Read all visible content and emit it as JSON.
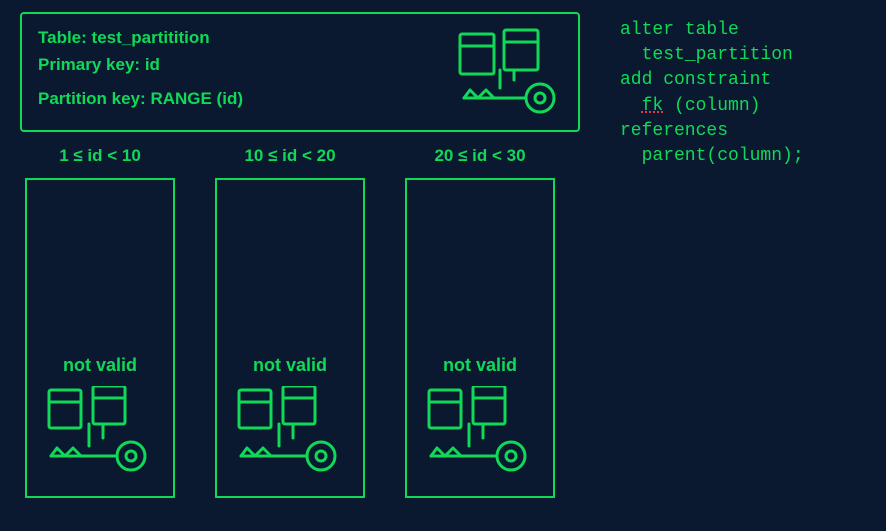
{
  "table": {
    "title_label": "Table:",
    "title_value": "test_partitition",
    "pk_label": "Primary key:",
    "pk_value": "id",
    "partkey_label": "Partition key:",
    "partkey_value": "RANGE (id)"
  },
  "partitions": [
    {
      "range": "1 ≤ id < 10",
      "status": "not valid"
    },
    {
      "range": "10 ≤ id < 20",
      "status": "not valid"
    },
    {
      "range": "20 ≤ id < 30",
      "status": "not valid"
    }
  ],
  "code": {
    "l1": "alter table",
    "l2": "  test_partition",
    "l3": "add constraint",
    "l4a": "  ",
    "l4_fk": "fk",
    "l4b": " (column)",
    "l5": "references",
    "l6": "  parent(column);"
  },
  "colors": {
    "bg": "#0a1830",
    "fg": "#10d958"
  }
}
